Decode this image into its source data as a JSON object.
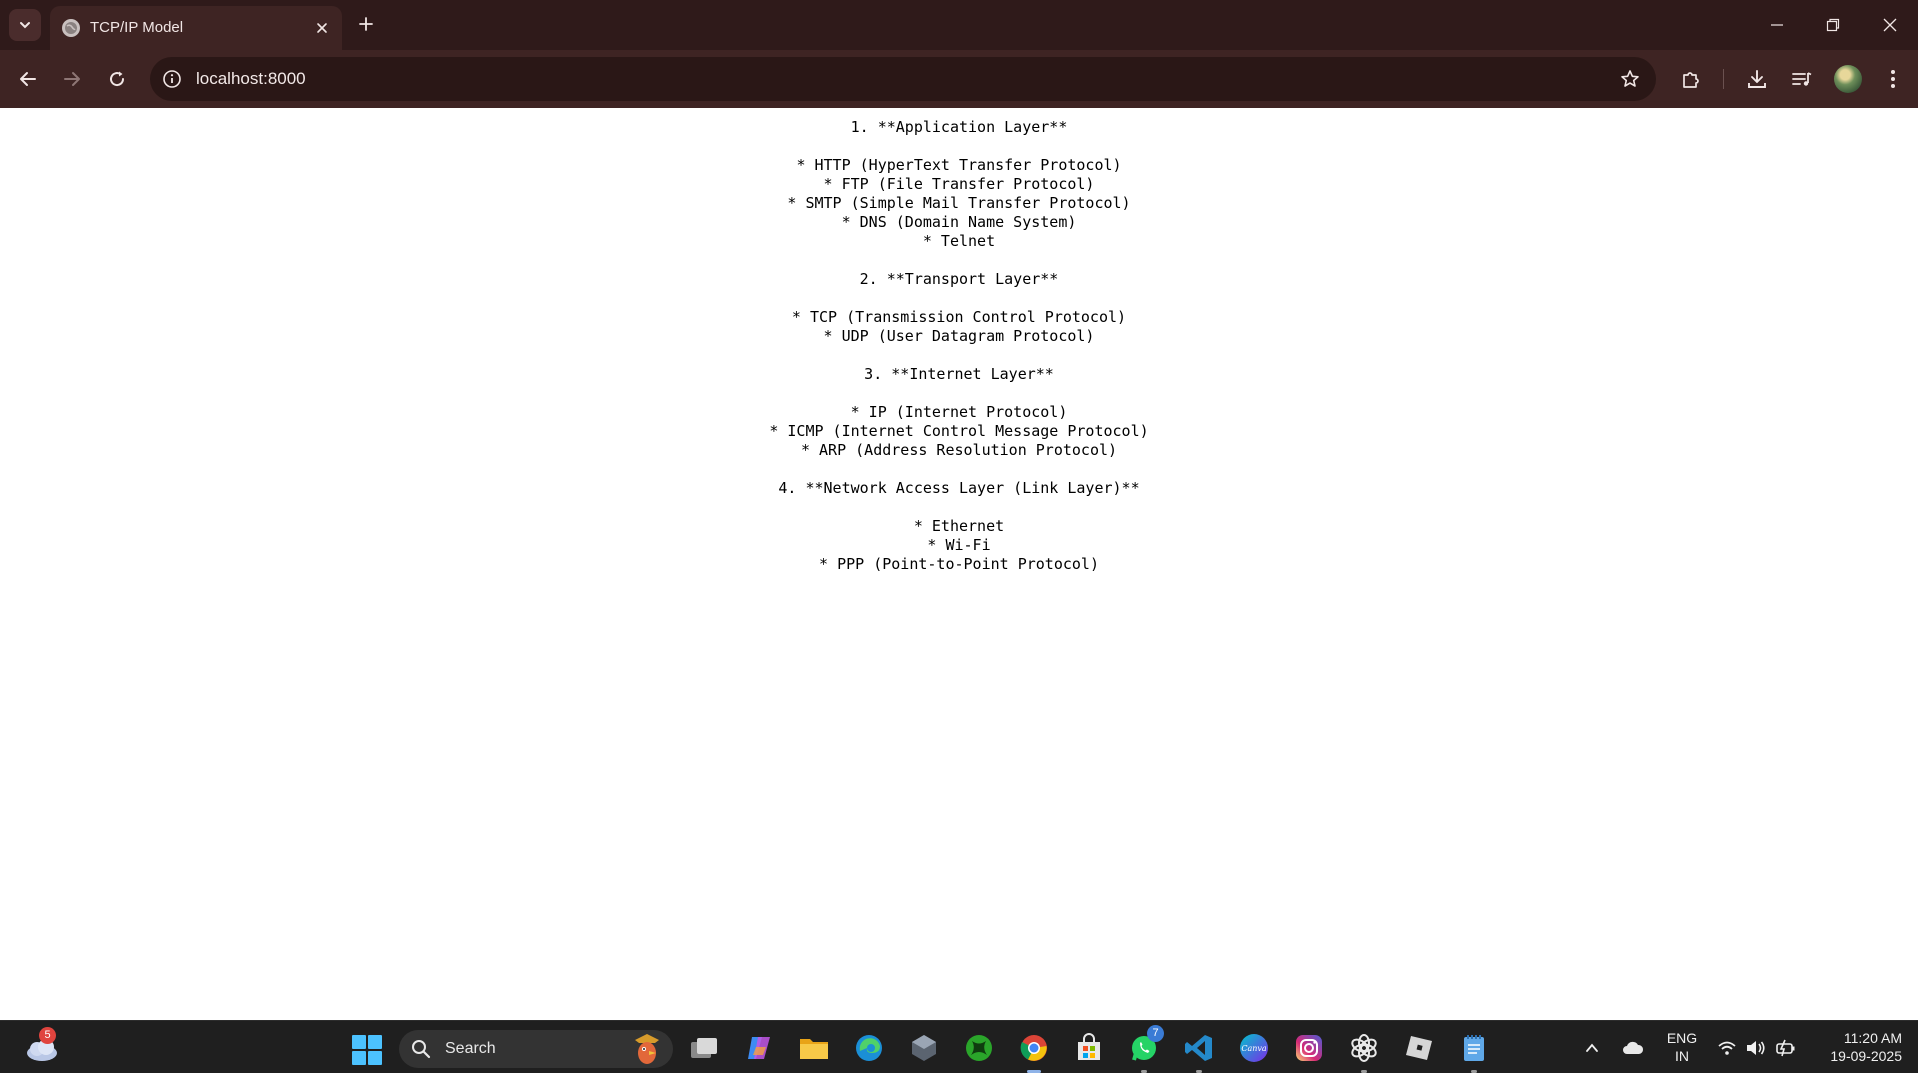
{
  "browser": {
    "tab": {
      "title": "TCP/IP Model",
      "favicon": "globe-icon"
    },
    "address_bar": {
      "url": "localhost:8000"
    },
    "colors": {
      "tabstrip": "#2f1a1a",
      "toolbar": "#3e2423",
      "omnibox": "#2a1716"
    }
  },
  "page": {
    "lines": [
      "1. **Application Layer**",
      "",
      "* HTTP (HyperText Transfer Protocol)",
      "* FTP (File Transfer Protocol)",
      "* SMTP (Simple Mail Transfer Protocol)",
      "* DNS (Domain Name System)",
      "* Telnet",
      "",
      "2. **Transport Layer**",
      "",
      "* TCP (Transmission Control Protocol)",
      "* UDP (User Datagram Protocol)",
      "",
      "3. **Internet Layer**",
      "",
      "* IP (Internet Protocol)",
      "* ICMP (Internet Control Message Protocol)",
      "* ARP (Address Resolution Protocol)",
      "",
      "4. **Network Access Layer (Link Layer)**",
      "",
      "* Ethernet",
      "* Wi-Fi",
      "* PPP (Point-to-Point Protocol)"
    ]
  },
  "taskbar": {
    "weather_badge": "5",
    "search_label": "Search",
    "apps": [
      "task-view",
      "copilot",
      "file-explorer",
      "edge",
      "app-generic",
      "xbox",
      "chrome",
      "microsoft-store",
      "whatsapp",
      "vscode",
      "canva",
      "instagram",
      "chatgpt",
      "roblox",
      "notepad"
    ],
    "whatsapp_badge": "7",
    "canva_label": "Canva",
    "language": {
      "line1": "ENG",
      "line2": "IN"
    },
    "clock": {
      "time": "11:20 AM",
      "date": "19-09-2025"
    }
  }
}
